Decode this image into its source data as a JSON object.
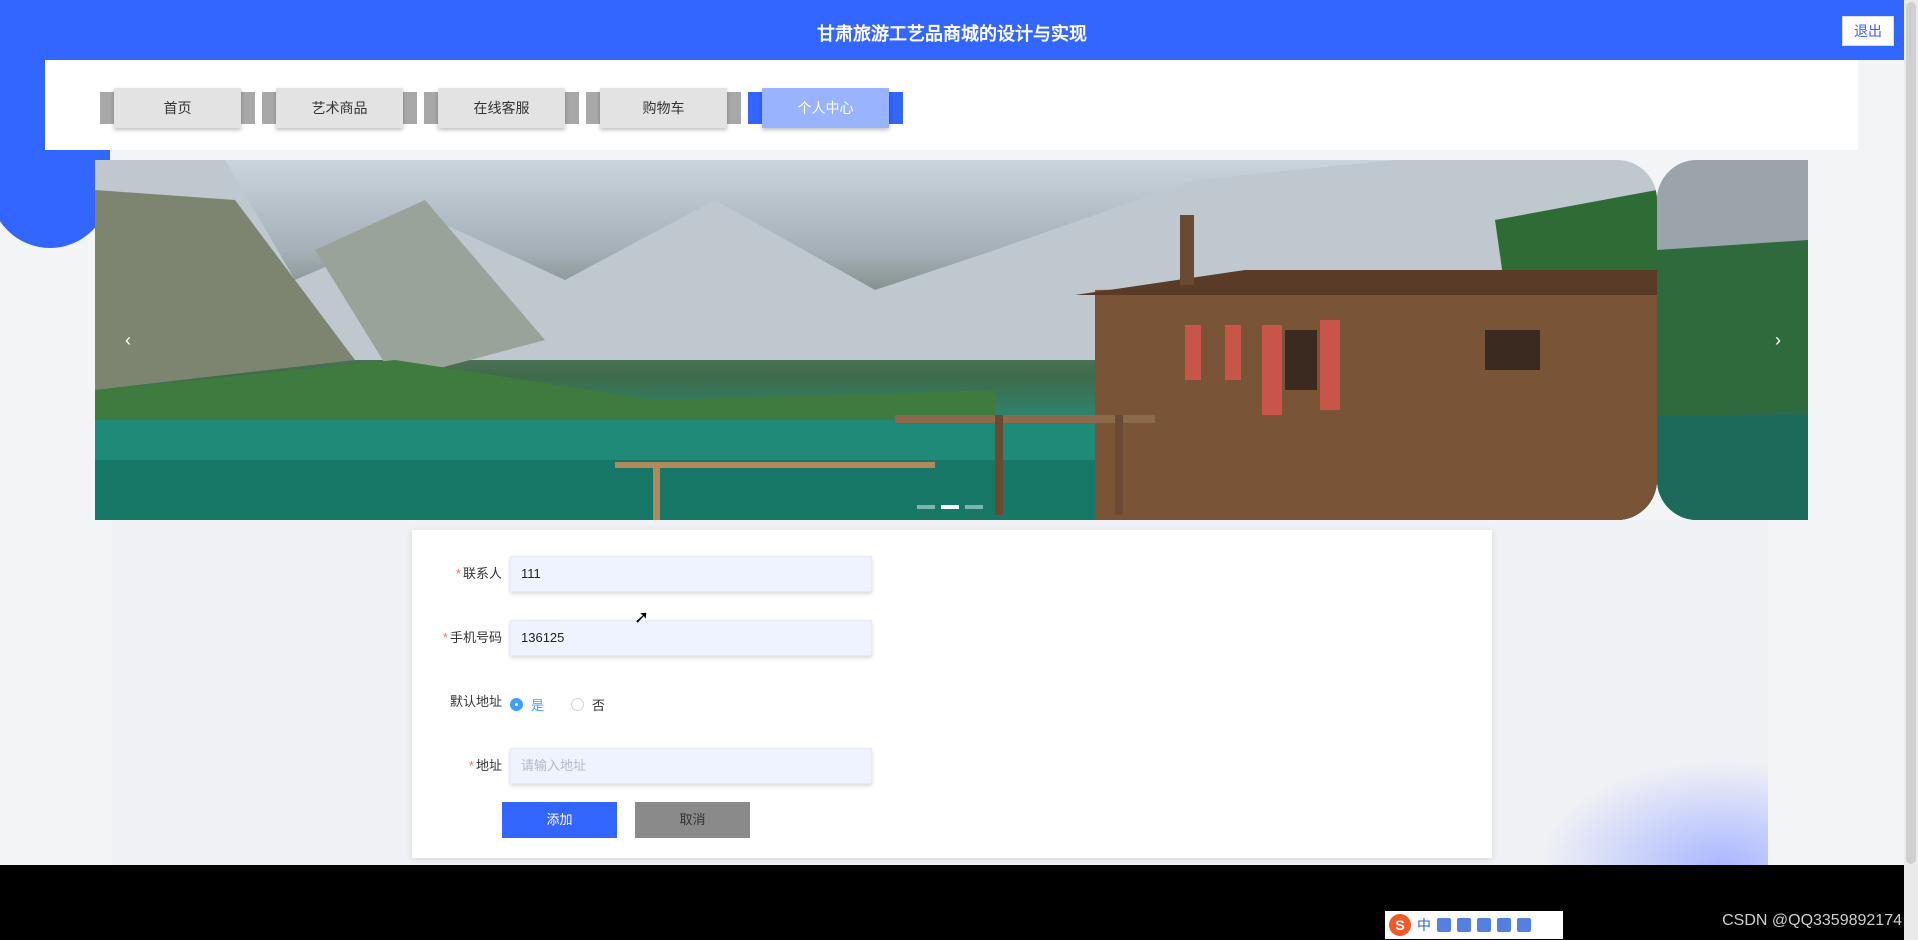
{
  "header": {
    "title": "甘肃旅游工艺品商城的设计与实现",
    "logout_label": "退出"
  },
  "nav": {
    "items": [
      {
        "label": "首页"
      },
      {
        "label": "艺术商品"
      },
      {
        "label": "在线客服"
      },
      {
        "label": "购物车"
      },
      {
        "label": "个人中心",
        "active": true
      }
    ]
  },
  "carousel": {
    "prev_icon": "‹",
    "next_icon": "›",
    "indicator_count": 3,
    "active_indicator": 1
  },
  "form": {
    "contact_label": "联系人",
    "contact_value": "111",
    "phone_label": "手机号码",
    "phone_value": "136125",
    "default_label": "默认地址",
    "option_yes": "是",
    "option_no": "否",
    "address_label": "地址",
    "address_placeholder": "请输入地址",
    "submit_label": "添加",
    "cancel_label": "取消"
  },
  "taskbar": {
    "ime_label": "中",
    "ime_logo": "S",
    "watermark": "CSDN @QQ3359892174"
  },
  "colors": {
    "primary": "#3366ff",
    "required": "#f56c6c",
    "radio_active": "#409eff"
  }
}
